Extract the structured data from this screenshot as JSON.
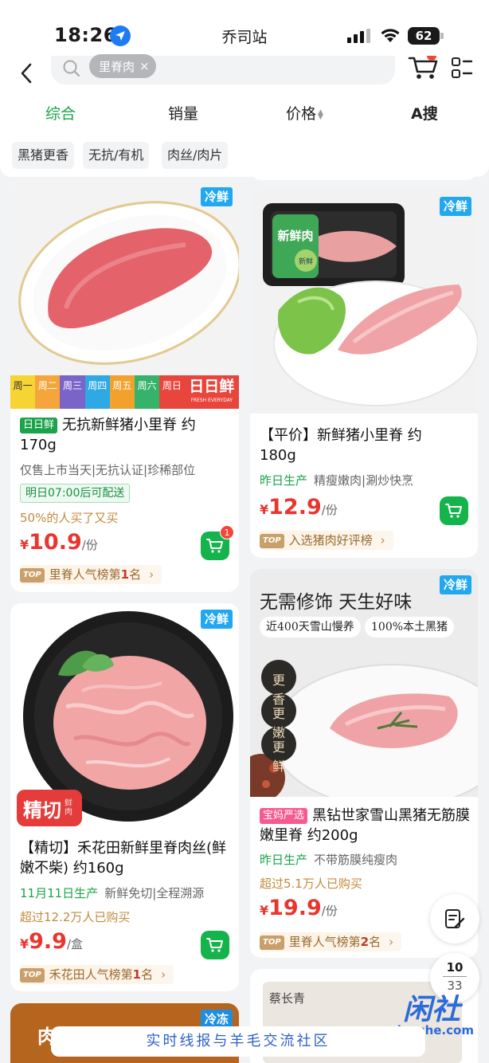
{
  "status_bar": {
    "time": "18:26",
    "title": "乔司站",
    "battery": "62"
  },
  "search": {
    "chip": "里脊肉",
    "chip_close": "×"
  },
  "sort_tabs": [
    {
      "label": "综合",
      "active": true
    },
    {
      "label": "销量",
      "active": false
    },
    {
      "label": "价格",
      "active": false
    },
    {
      "label": "A搜",
      "active": false
    }
  ],
  "filters": [
    "黑猪更香",
    "无抗/有机",
    "肉丝/肉片"
  ],
  "products": [
    {
      "badge": "冷鲜",
      "tag": "日日鲜",
      "title": "无抗新鲜猪小里脊 约170g",
      "subtitle": "仅售上市当天|无抗认证|珍稀部位",
      "delivery": "明日07:00后可配送",
      "note": "50%的人买了又买",
      "price": "10.9",
      "unit": "/份",
      "cart_count": "1",
      "rank_prefix": "里脊人气榜第",
      "rank_num": "1",
      "rank_suffix": "名",
      "strip_days": [
        "周一",
        "周二",
        "周三",
        "周四",
        "周五",
        "周六",
        "周日"
      ],
      "strip_logo": "日日鲜",
      "strip_en": "FRESH EVERYDAY"
    },
    {
      "badge": "冷鲜",
      "title": "【平价】新鲜猪小里脊 约180g",
      "date": "昨日生产",
      "subtitle": "精瘦嫩肉|涮炒快烹",
      "price": "12.9",
      "unit": "/份",
      "rank_text": "入选猪肉好评榜",
      "package_label": "新鲜肉",
      "package_seal": "新鲜"
    },
    {
      "badge": "冷鲜",
      "ribbon": "精切",
      "ribbon_small": "鲜肉",
      "title": "【精切】禾花田新鲜里脊肉丝(鲜嫩不柴) 约160g",
      "date": "11月11日生产",
      "subtitle": "新鲜免切|全程溯源",
      "note": "超过12.2万人已购买",
      "price": "9.9",
      "unit": "/盒",
      "rank_prefix": "禾花田人气榜第",
      "rank_num": "1",
      "rank_suffix": "名"
    },
    {
      "badge": "冷鲜",
      "tag": "宝妈严选",
      "title": "黑钻世家雪山黑猪无筋膜嫩里脊 约200g",
      "date": "昨日生产",
      "subtitle": "不带筋膜纯瘦肉",
      "note": "超过5.1万人已购买",
      "price": "19.9",
      "unit": "/份",
      "rank_prefix": "里脊人气榜第",
      "rank_num": "2",
      "rank_suffix": "名",
      "ad_headline": "无需修饰 天生好味",
      "ad_pill1": "近400天雪山慢养",
      "ad_pill2": "100%本土黑猪",
      "ad_circles": [
        "更香",
        "更嫩",
        "更鲜"
      ]
    },
    {
      "badge": "冷冻",
      "text": "肉"
    },
    {
      "brand": "蔡长青"
    }
  ],
  "pager": {
    "current": "10",
    "total": "33"
  },
  "banner": "实时线报与羊毛交流社区",
  "watermark": {
    "name": "闲社",
    "url": "xianshe.com"
  },
  "colors": {
    "green": "#1aa34a",
    "price_red": "#e8362f",
    "cold_blue": "#21a8f0"
  }
}
